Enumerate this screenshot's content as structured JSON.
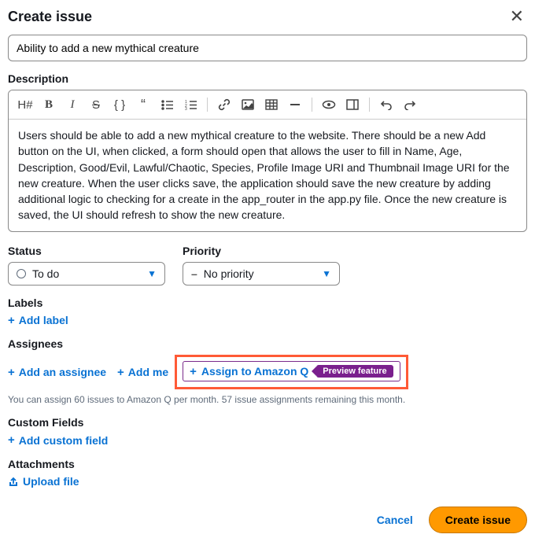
{
  "modal": {
    "title": "Create issue",
    "issue_title_value": "Ability to add a new mythical creature",
    "description_label": "Description",
    "description_text": "Users should be able to add a new mythical creature to the website.  There should be a new Add button on the UI, when clicked, a form should open that allows the user to fill in Name, Age, Description, Good/Evil, Lawful/Chaotic, Species, Profile Image URI and Thumbnail Image URI for the new creature.  When the user clicks save, the application should save the new creature by adding additional logic to checking for a create in the app_router in the app.py file.  Once the new creature is saved, the UI should refresh to show the new creature."
  },
  "toolbar": {
    "heading": "H#",
    "bold": "B",
    "italic": "I",
    "strike": "S",
    "braces": "{ }",
    "quote": "“"
  },
  "status": {
    "label": "Status",
    "value": "To do"
  },
  "priority": {
    "label": "Priority",
    "value": "No priority"
  },
  "labels": {
    "label": "Labels",
    "add": "Add label"
  },
  "assignees": {
    "label": "Assignees",
    "add_assignee": "Add an assignee",
    "add_me": "Add me",
    "assign_amazon_q": "Assign to Amazon Q",
    "preview_badge": "Preview feature",
    "helper": "You can assign 60 issues to Amazon Q per month. 57 issue assignments remaining this month."
  },
  "custom_fields": {
    "label": "Custom Fields",
    "add": "Add custom field"
  },
  "attachments": {
    "label": "Attachments",
    "upload": "Upload file"
  },
  "footer": {
    "cancel": "Cancel",
    "submit": "Create issue"
  }
}
